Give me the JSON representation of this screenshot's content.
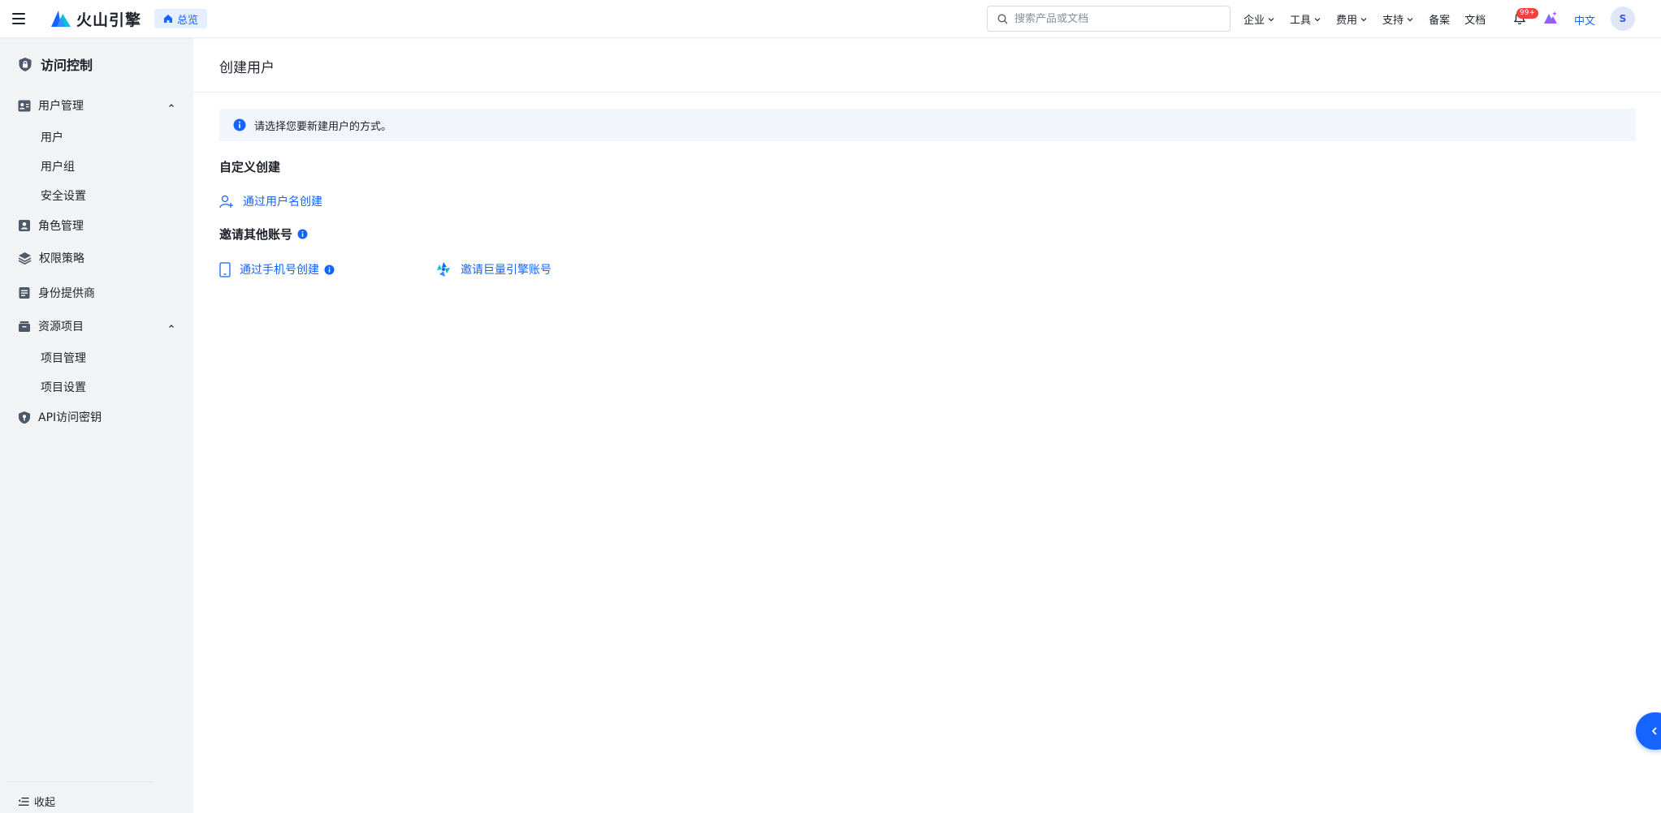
{
  "topbar": {
    "brand_name": "火山引擎",
    "overview_label": "总览",
    "search_placeholder": "搜索产品或文档",
    "nav": [
      "企业",
      "工具",
      "费用",
      "支持",
      "备案",
      "文档"
    ],
    "badge": "99+",
    "lang": "中文",
    "avatar_initial": "S"
  },
  "sidebar": {
    "title": "访问控制",
    "user_mgmt": {
      "label": "用户管理",
      "children": [
        "用户",
        "用户组",
        "安全设置"
      ]
    },
    "role_mgmt": "角色管理",
    "policy": "权限策略",
    "idp": "身份提供商",
    "resource": {
      "label": "资源项目",
      "children": [
        "项目管理",
        "项目设置"
      ]
    },
    "api_keys": "API访问密钥",
    "collapse": "收起"
  },
  "main": {
    "page_title": "创建用户",
    "alert_text": "请选择您要新建用户的方式。",
    "custom_section": "自定义创建",
    "by_username": "通过用户名创建",
    "invite_section": "邀请其他账号",
    "by_phone": "通过手机号创建",
    "invite_juliang": "邀请巨量引擎账号"
  },
  "colors": {
    "accent": "#1664ff",
    "sidebar_bg": "#f2f3f5",
    "badge": "#f53f3f",
    "alert_bg": "#f2f5fb"
  }
}
